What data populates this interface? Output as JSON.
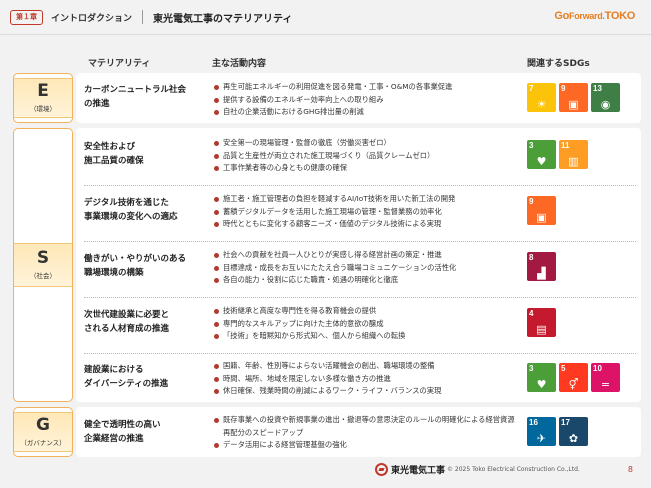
{
  "header": {
    "chapter_label": "第１章",
    "section": "イントロダクション",
    "title": "東光電気工事のマテリアリティ"
  },
  "brand": {
    "go": "Go",
    "forward": "Forward.",
    "toko": "TOKO"
  },
  "columns": {
    "materiality": "マテリアリティ",
    "activities": "主な活動内容",
    "sdgs": "関連するSDGs"
  },
  "categories": {
    "e": {
      "letter": "E",
      "label": "（環境）"
    },
    "s": {
      "letter": "S",
      "label": "（社会）"
    },
    "g": {
      "letter": "G",
      "label": "（ガバナンス）"
    }
  },
  "rows": [
    {
      "theme": "カーボンニュートラル社会の推進",
      "theme_lines": [
        "カーボンニュートラル社会",
        "の推進"
      ],
      "activities": [
        "再生可能エネルギーの利用促進を図る発電・工事・O&Mの各事業促進",
        "提供する設備のエネルギー効率向上への取り組み",
        "自社の企業活動におけるGHG排出量の削減"
      ],
      "sdgs": [
        {
          "num": "7",
          "color": "#fcc30b",
          "icon": "sun-icon"
        },
        {
          "num": "9",
          "color": "#fd6925",
          "icon": "cubes-icon"
        },
        {
          "num": "13",
          "color": "#3f7e44",
          "icon": "eye-globe-icon"
        }
      ]
    },
    {
      "theme_lines": [
        "安全性および",
        "施工品質の確保"
      ],
      "activities": [
        "安全第一の現場管理・監督の徹底（労働災害ゼロ）",
        "品質と生産性が両立された施工現場づくり（品質クレームゼロ）",
        "工事作業者等の心身ともの健康の確保"
      ],
      "sdgs": [
        {
          "num": "3",
          "color": "#4c9f38",
          "icon": "heartbeat-icon"
        },
        {
          "num": "11",
          "color": "#fd9d24",
          "icon": "city-icon"
        }
      ]
    },
    {
      "theme_lines": [
        "デジタル技術を通じた",
        "事業環境の変化への適応"
      ],
      "activities": [
        "施工者・施工管理者の負担を軽減するAI/IoT技術を用いた新工法の開発",
        "蓄積デジタルデータを活用した施工現場の管理・監督業務の効率化",
        "時代とともに変化する顧客ニーズ・価値のデジタル技術による実現"
      ],
      "sdgs": [
        {
          "num": "9",
          "color": "#fd6925",
          "icon": "cubes-icon"
        }
      ]
    },
    {
      "theme_lines": [
        "働きがい・やりがいのある",
        "職場環境の構築"
      ],
      "activities": [
        "社会への貢献を社員一人ひとりが実感し得る経営計画の策定・推進",
        "目標達成・成長をお互いにたたえ合う職場コミュニケーションの活性化",
        "各自の能力・役割に応じた職責・処遇の明確化と徹底"
      ],
      "sdgs": [
        {
          "num": "8",
          "color": "#a21942",
          "icon": "growth-chart-icon"
        }
      ]
    },
    {
      "theme_lines": [
        "次世代建設業に必要と",
        "される人材育成の推進"
      ],
      "activities": [
        "技術継承と高度な専門性を得る教育機会の提供",
        "専門的なスキルアップに向けた主体的意欲の醸成",
        "「技術」を暗黙知から形式知へ、個人から組織への転換"
      ],
      "sdgs": [
        {
          "num": "4",
          "color": "#c5192d",
          "icon": "book-icon"
        }
      ]
    },
    {
      "theme_lines": [
        "建設業における",
        "ダイバーシティの推進"
      ],
      "activities": [
        "国籍、年齢、性別等によらない活躍機会の創出、職場環境の整備",
        "時間、場所、地域を限定しない多様な働き方の推進",
        "休日確保、残業時間の削減によるワーク・ライフ・バランスの実現"
      ],
      "sdgs": [
        {
          "num": "3",
          "color": "#4c9f38",
          "icon": "heartbeat-icon"
        },
        {
          "num": "5",
          "color": "#ff3a21",
          "icon": "gender-equality-icon"
        },
        {
          "num": "10",
          "color": "#dd1367",
          "icon": "equality-icon"
        }
      ]
    },
    {
      "theme_lines": [
        "健全で透明性の高い",
        "企業経営の推進"
      ],
      "activities": [
        "既存事業への投資や新規事業の進出・撤退等の意思決定のルールの明確化による経営資源再配分のスピードアップ",
        "データ活用による経営管理基盤の強化"
      ],
      "sdgs": [
        {
          "num": "16",
          "color": "#00689d",
          "icon": "dove-icon"
        },
        {
          "num": "17",
          "color": "#19486a",
          "icon": "partnership-icon"
        }
      ]
    }
  ],
  "footer": {
    "company": "東光電気工事",
    "copyright": "© 2025 Toko Electrical Construction Co.,Ltd.",
    "page": "8"
  }
}
